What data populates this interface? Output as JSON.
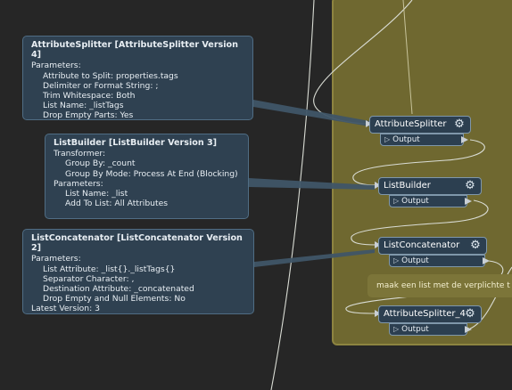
{
  "annotations": [
    {
      "title": "AttributeSplitter [AttributeSplitter Version 4]",
      "lines": [
        {
          "text": "Parameters:",
          "indent": 0
        },
        {
          "text": "Attribute to Split: properties.tags",
          "indent": 1
        },
        {
          "text": "Delimiter or Format String: ;",
          "indent": 1
        },
        {
          "text": "Trim Whitespace: Both",
          "indent": 1
        },
        {
          "text": "List Name: _listTags",
          "indent": 1
        },
        {
          "text": "Drop Empty Parts: Yes",
          "indent": 1
        }
      ]
    },
    {
      "title": "ListBuilder [ListBuilder Version 3]",
      "lines": [
        {
          "text": "Transformer:",
          "indent": 0
        },
        {
          "text": "Group By: _count",
          "indent": 1
        },
        {
          "text": "Group By Mode: Process At End (Blocking)",
          "indent": 1
        },
        {
          "text": "Parameters:",
          "indent": 0
        },
        {
          "text": "List Name: _list",
          "indent": 1
        },
        {
          "text": "Add To List: All Attributes",
          "indent": 1
        }
      ]
    },
    {
      "title": "ListConcatenator [ListConcatenator Version 2]",
      "lines": [
        {
          "text": "Parameters:",
          "indent": 0
        },
        {
          "text": "List Attribute: _list{}._listTags{}",
          "indent": 1
        },
        {
          "text": "Separator Character: ,",
          "indent": 1
        },
        {
          "text": "Destination Attribute: _concatenated",
          "indent": 1
        },
        {
          "text": "Drop Empty and Null Elements: No",
          "indent": 1
        },
        {
          "text": "Latest Version: 3",
          "indent": 0
        }
      ]
    }
  ],
  "transformers": [
    {
      "name": "AttributeSplitter",
      "port": "Output",
      "icon": "gear-icon"
    },
    {
      "name": "ListBuilder",
      "port": "Output",
      "icon": "gear-icon"
    },
    {
      "name": "ListConcatenator",
      "port": "Output",
      "icon": "gear-icon"
    },
    {
      "name": "AttributeSplitter_4",
      "port": "Output",
      "icon": "gear-icon"
    }
  ],
  "sticky_note": "maak een list met de verplichte t",
  "colors": {
    "canvas": "#262626",
    "bookmark": "#6f6830",
    "annotation": "#2f4151",
    "transformer": "#2c3f50",
    "connection": "#d9dcd4"
  }
}
